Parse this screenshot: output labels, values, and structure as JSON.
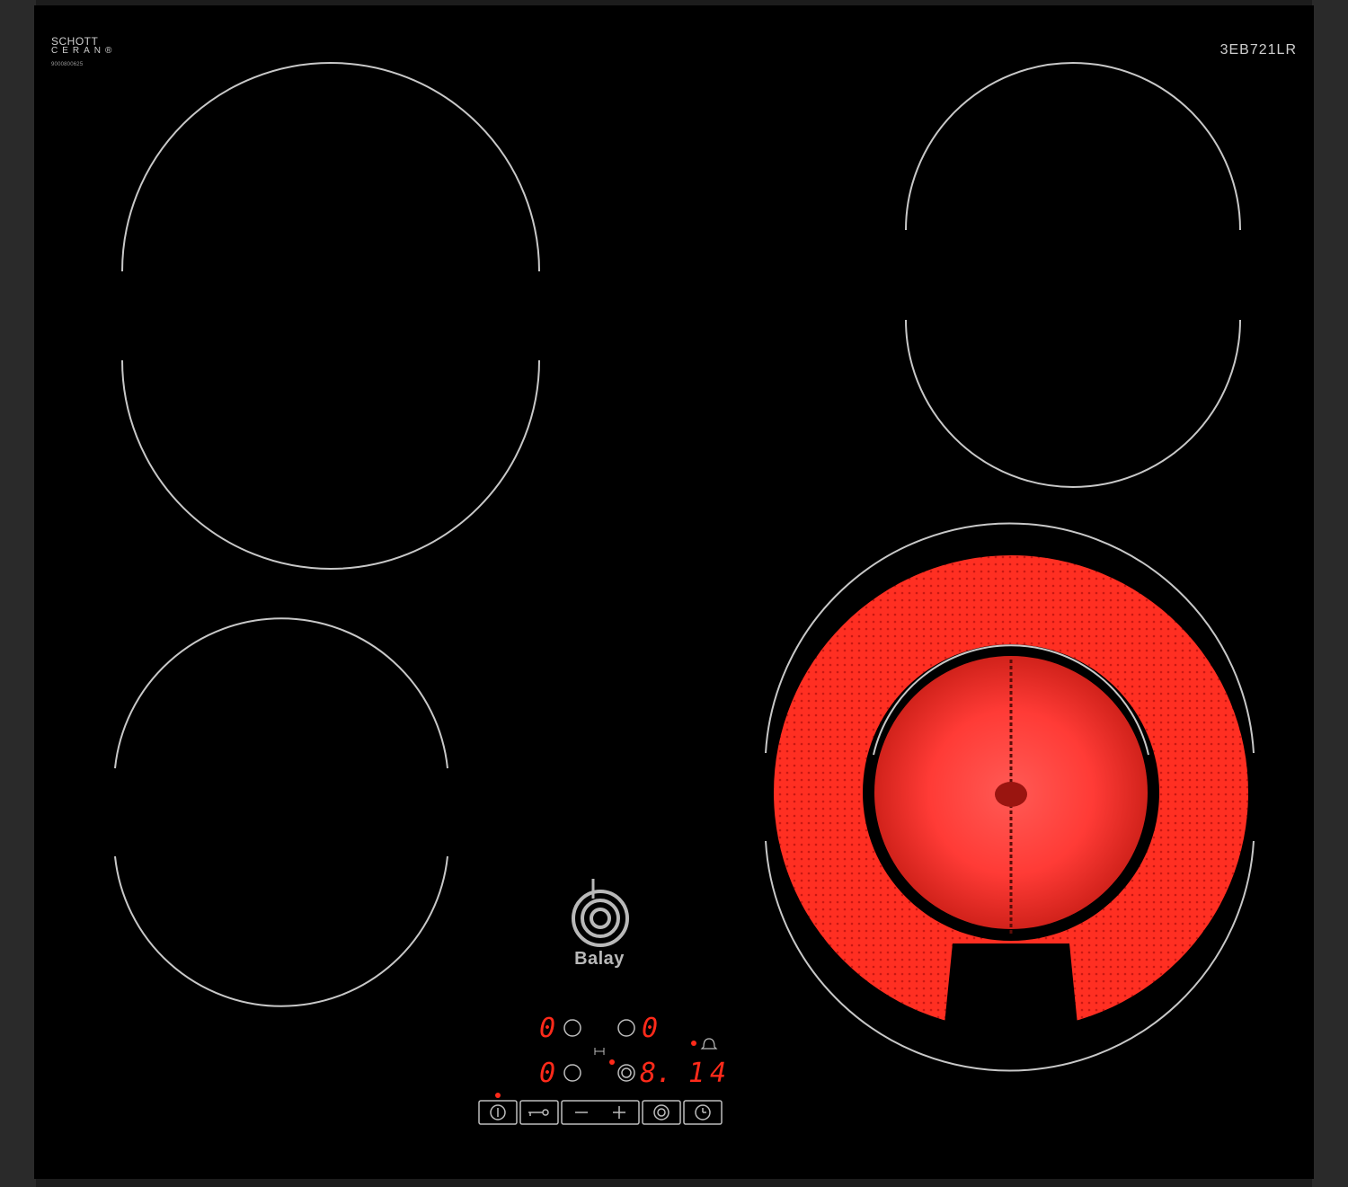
{
  "brand": {
    "glass_brand_line1": "SCHOTT",
    "glass_brand_line2": "CERAN®",
    "serial": "9000800625",
    "model": "3EB721LR",
    "logo_text": "Balay"
  },
  "control_panel": {
    "displays": {
      "zone_top_left": "0",
      "zone_top_right": "0",
      "zone_bottom_left": "0",
      "zone_bottom_right": "8.",
      "timer": "14"
    },
    "buttons": [
      {
        "name": "power-button",
        "icon": "power-icon"
      },
      {
        "name": "lock-button",
        "icon": "key-icon"
      },
      {
        "name": "minus-button",
        "icon": "minus-icon"
      },
      {
        "name": "plus-button",
        "icon": "plus-icon"
      },
      {
        "name": "dual-zone-button",
        "icon": "dual-ring-icon"
      },
      {
        "name": "timer-button",
        "icon": "clock-icon"
      }
    ]
  },
  "zones": [
    {
      "name": "cooking-zone-top-left",
      "state": "off"
    },
    {
      "name": "cooking-zone-top-right",
      "state": "off"
    },
    {
      "name": "cooking-zone-bottom-left",
      "state": "off"
    },
    {
      "name": "cooking-zone-bottom-right",
      "state": "on",
      "dual_circuit": true
    }
  ],
  "colors": {
    "glass": "#000000",
    "frame": "#222222",
    "zone_outline": "#c8c8c8",
    "heat_glow": "#ff2a1a",
    "display": "#ff2a1a"
  }
}
